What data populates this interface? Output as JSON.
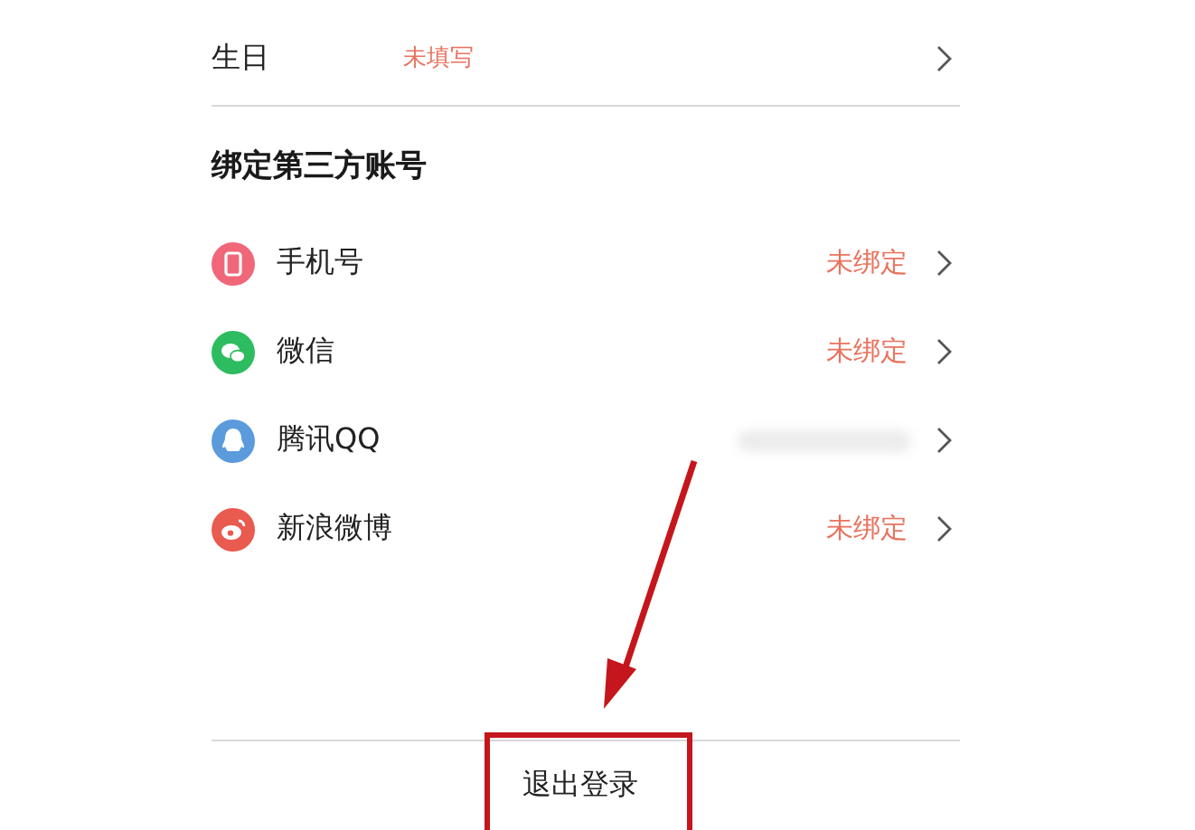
{
  "profile_row": {
    "label": "生日",
    "value": "未填写"
  },
  "section_title": "绑定第三方账号",
  "accounts": [
    {
      "kind": "phone",
      "name": "手机号",
      "color": "#f0677a",
      "status_hidden": false,
      "status": "未绑定"
    },
    {
      "kind": "wechat",
      "name": "微信",
      "color": "#2dbc5f",
      "status_hidden": false,
      "status": "未绑定"
    },
    {
      "kind": "qq",
      "name": "腾讯QQ",
      "color": "#5b9bdc",
      "status_hidden": true
    },
    {
      "kind": "weibo",
      "name": "新浪微博",
      "color": "#e95a4f",
      "status_hidden": false,
      "status": "未绑定"
    }
  ],
  "logout_button": {
    "label": "退出登录"
  }
}
